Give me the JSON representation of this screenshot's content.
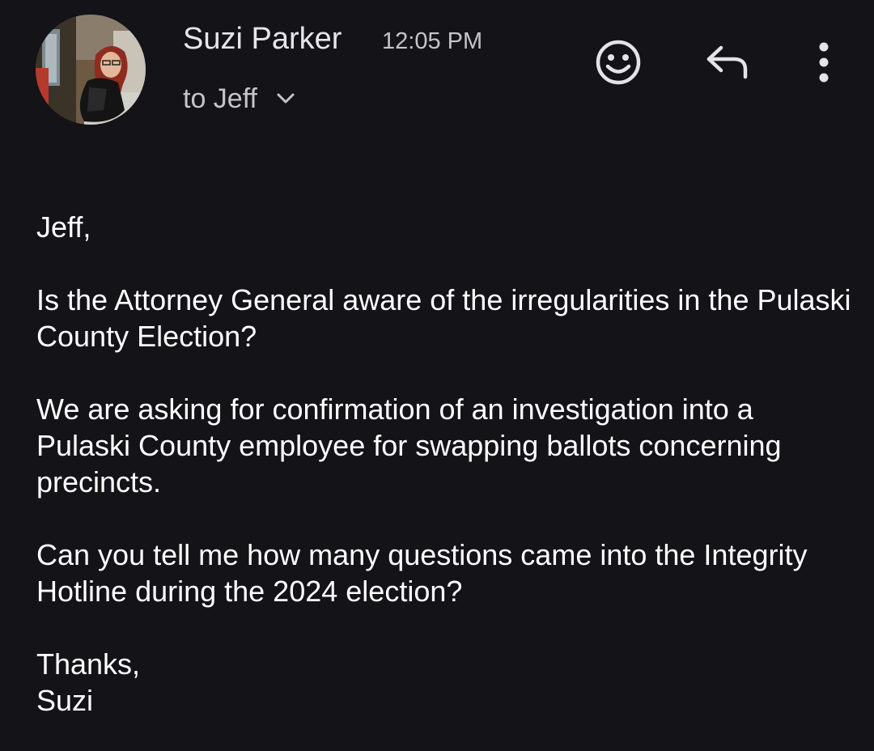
{
  "header": {
    "sender_name": "Suzi Parker",
    "time": "12:05 PM",
    "recipient_label": "to Jeff",
    "avatar_icon": "profile-photo",
    "actions": {
      "emoji_icon": "smiley-face-icon",
      "reply_icon": "reply-arrow-icon",
      "more_icon": "vertical-dots-icon"
    }
  },
  "message": {
    "greeting": "Jeff,",
    "paragraph_1": "Is the Attorney General aware of the irregularities in the Pulaski County Election?",
    "paragraph_2": "We are asking for confirmation of an investigation into a Pulaski County employee for swapping ballots concerning precincts.",
    "paragraph_3": "Can you tell me how many questions came into the Integrity Hotline during the 2024 election?",
    "signoff": "Thanks,",
    "signature": "Suzi"
  },
  "colors": {
    "background": "#131318",
    "text_primary": "#ffffff",
    "text_secondary": "#c4c4c9",
    "icon": "#e3e3e8"
  }
}
